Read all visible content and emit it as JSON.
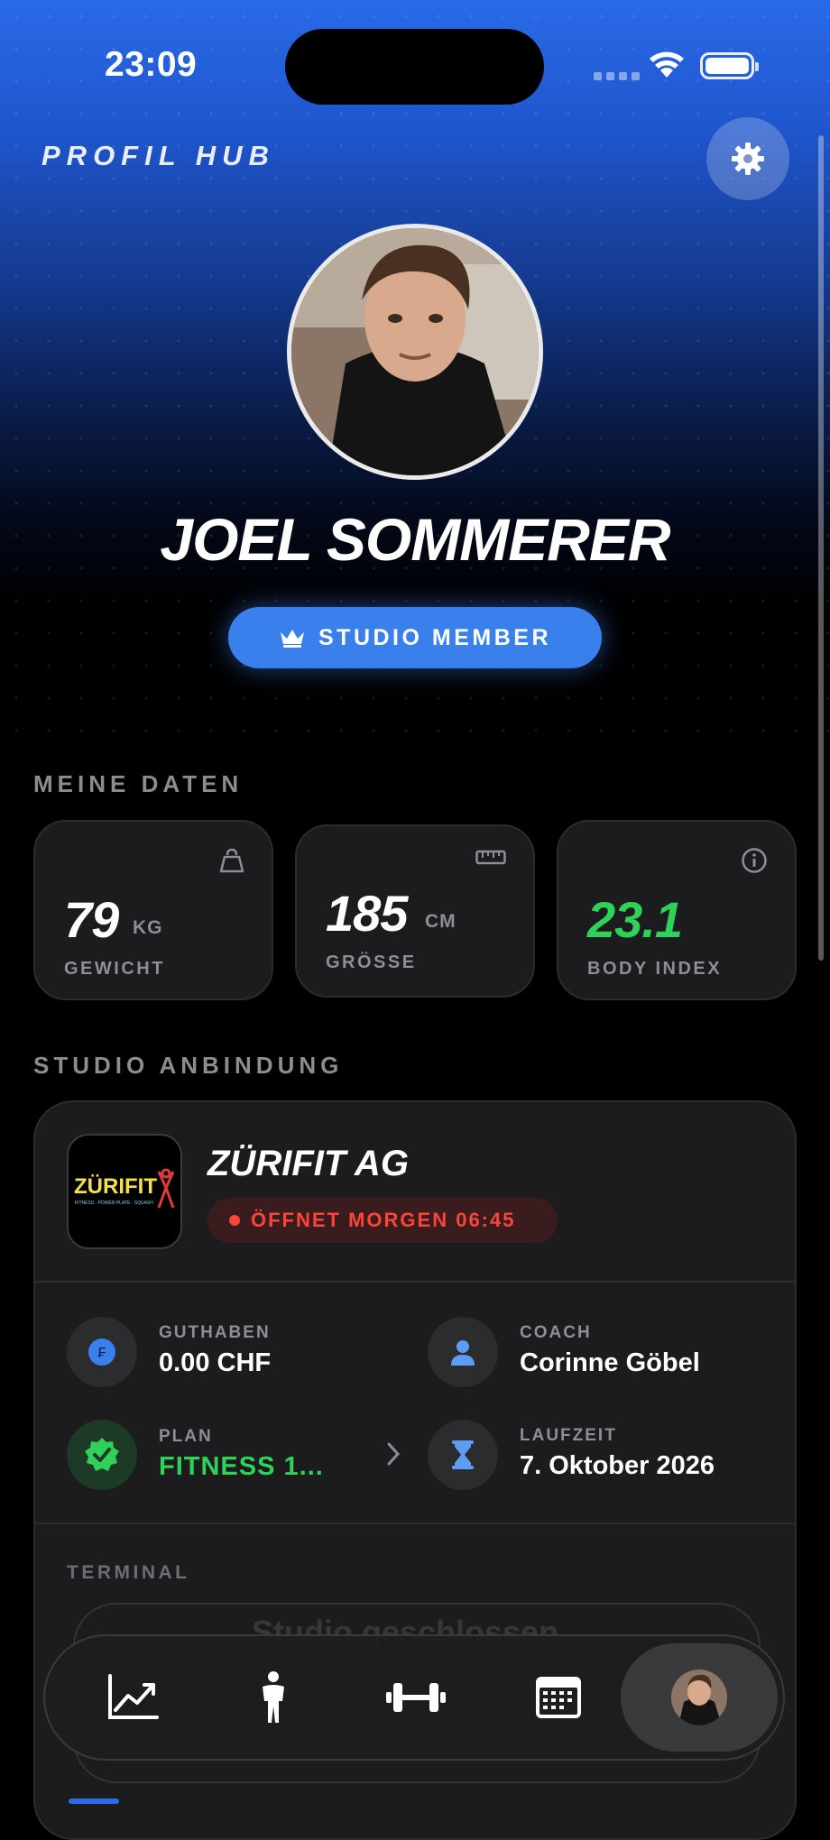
{
  "status_bar": {
    "time": "23:09"
  },
  "header": {
    "title": "PROFIL HUB",
    "settings_icon": "gear-icon"
  },
  "profile": {
    "name": "JOEL SOMMERER",
    "badge_label": "STUDIO MEMBER",
    "badge_icon": "crown-icon"
  },
  "my_data": {
    "title": "MEINE DATEN",
    "weight": {
      "value": "79",
      "unit": "KG",
      "label": "GEWICHT",
      "icon": "kettlebell-icon"
    },
    "height": {
      "value": "185",
      "unit": "CM",
      "label": "GRÖSSE",
      "icon": "ruler-icon"
    },
    "bmi": {
      "value": "23.1",
      "label": "BODY INDEX",
      "icon": "info-icon",
      "color": "#30d158"
    }
  },
  "studio": {
    "title": "STUDIO ANBINDUNG",
    "name": "ZÜRIFIT AG",
    "logo_text": "ZÜRIFIT",
    "logo_tagline": "FITNESS · POWER PLATE · SQUASH",
    "status": "ÖFFNET MORGEN 06:45",
    "balance": {
      "label": "GUTHABEN",
      "value": "0.00 CHF"
    },
    "coach": {
      "label": "COACH",
      "value": "Corinne Göbel"
    },
    "plan": {
      "label": "PLAN",
      "value": "FITNESS 1...",
      "color": "#30d158"
    },
    "term": {
      "label": "LAUFZEIT",
      "value": "7. Oktober 2026"
    },
    "terminal": {
      "label": "TERMINAL",
      "ghost_text": "Studio geschlossen"
    }
  },
  "tabbar": {
    "items": [
      {
        "name": "stats",
        "icon": "chart-line-icon"
      },
      {
        "name": "body",
        "icon": "person-icon"
      },
      {
        "name": "workout",
        "icon": "dumbbell-icon"
      },
      {
        "name": "calendar",
        "icon": "calendar-icon"
      },
      {
        "name": "profile",
        "icon": "avatar-icon",
        "active": true
      }
    ]
  },
  "colors": {
    "accent": "#3a80ec",
    "success": "#30d158",
    "danger": "#ff453a",
    "card": "#1c1c1e"
  }
}
